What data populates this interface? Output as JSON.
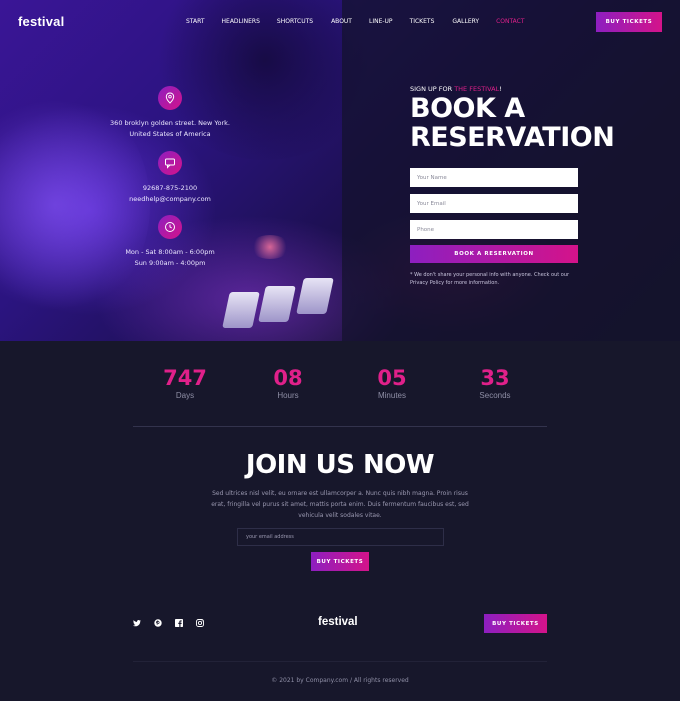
{
  "nav": {
    "logo": "festival",
    "items": [
      "START",
      "HEADLINERS",
      "SHORTCUTS",
      "ABOUT",
      "LINE-UP",
      "TICKETS",
      "GALLERY",
      "CONTACT"
    ],
    "active": "CONTACT",
    "cta": "BUY TICKETS"
  },
  "contact": {
    "address": [
      "360 broklyn golden street. New York.",
      "United States of America"
    ],
    "phone": "92687-875-2100",
    "email": "needhelp@company.com",
    "hours": [
      "Mon - Sat 8:00am - 6:00pm",
      "Sun 9:00am - 4:00pm"
    ]
  },
  "reservation": {
    "signup_prefix": "SIGN UP FOR",
    "signup_accent": "THE FESTIVAL",
    "signup_suffix": "!",
    "title_line1": "BOOK A",
    "title_line2": "RESERVATION",
    "name_placeholder": "Your Name",
    "email_placeholder": "Your Email",
    "phone_placeholder": "Phone",
    "submit": "BOOK A RESERVATION",
    "privacy": "* We don't share your personal info with anyone. Check out our Privacy Policy for more information."
  },
  "countdown": [
    {
      "value": "747",
      "label": "Days"
    },
    {
      "value": "08",
      "label": "Hours"
    },
    {
      "value": "05",
      "label": "Minutes"
    },
    {
      "value": "33",
      "label": "Seconds"
    }
  ],
  "join": {
    "title": "JOIN US NOW",
    "text": "Sed ultrices nisl velit, eu ornare est ullamcorper a. Nunc quis nibh magna. Proin risus erat, fringilla vel purus sit amet, mattis porta enim. Duis fermentum faucibus est, sed vehicula velit sodales vitae.",
    "email_placeholder": "your email address",
    "cta": "BUY TICKETS"
  },
  "footer": {
    "logo": "festival",
    "social": [
      "twitter-icon",
      "pinterest-icon",
      "facebook-icon",
      "instagram-icon"
    ],
    "cta": "BUY TICKETS",
    "copyright": "©  2021 by Company.com  /  All rights reserved"
  },
  "colors": {
    "accent": "#e0208a",
    "gradient_start": "#8d1fc0",
    "gradient_end": "#d4138a",
    "background": "#17172b"
  }
}
